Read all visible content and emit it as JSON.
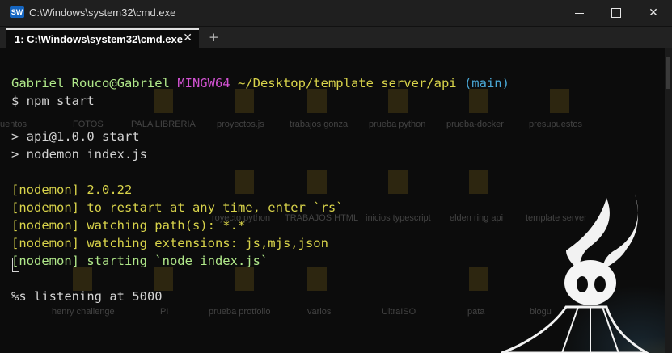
{
  "window": {
    "icon_text": "SW",
    "title": "C:\\Windows\\system32\\cmd.exe",
    "controls": {
      "minimize": "minimize",
      "maximize": "maximize",
      "close": "close"
    }
  },
  "tabs": [
    {
      "label": "1: C:\\Windows\\system32\\cmd.exe",
      "close": "✕"
    }
  ],
  "new_tab": "+",
  "prompt": {
    "user": "Gabriel Rouco@Gabriel",
    "env": "MINGW64",
    "path": "~/Desktop/template server/api",
    "branch": "(main)",
    "command": "$ npm start"
  },
  "output": [
    "> api@1.0.0 start",
    "> nodemon index.js",
    "[nodemon] 2.0.22",
    "[nodemon] to restart at any time, enter `rs`",
    "[nodemon] watching path(s): *.*",
    "[nodemon] watching extensions: js,mjs,json",
    "[nodemon] starting `node index.js`",
    "%s listening at 5000"
  ],
  "desktop_labels": [
    "uentos",
    "FOTOS",
    "PALA LIBRERIA",
    "proyectos.js",
    "trabajos gonza",
    "prueba python",
    "prueba-docker",
    "presupuestos",
    "royecto python",
    "TRABAJOS HTML",
    "inicios typescript",
    "elden ring api",
    "template server",
    "henry challenge",
    "PI",
    "prueba protfolio",
    "varios",
    "UltraISO",
    "pata",
    "blogu"
  ],
  "colors": {
    "terminal_bg": "#0c0c0c",
    "green": "#b0e88a",
    "magenta": "#d152d1",
    "yellow": "#d8d34a",
    "cyan": "#4aa9d8"
  }
}
